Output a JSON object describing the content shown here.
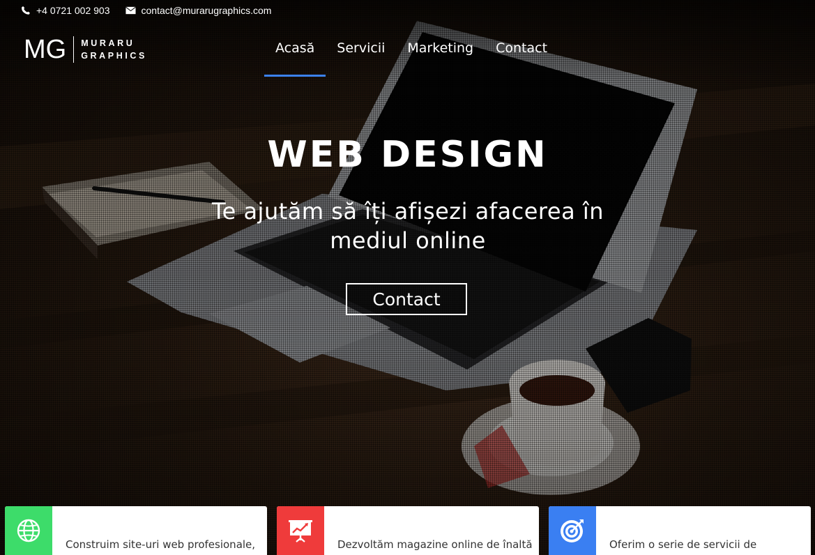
{
  "topbar": {
    "phone": "+4 0721 002 903",
    "email": "contact@murarugraphics.com",
    "phone_icon": "phone-icon",
    "email_icon": "envelope-icon"
  },
  "logo": {
    "initials": "MG",
    "line1": "MURARU",
    "line2": "GRAPHICS"
  },
  "nav": {
    "items": [
      {
        "label": "Acasă",
        "active": true
      },
      {
        "label": "Servicii"
      },
      {
        "label": "Marketing"
      },
      {
        "label": "Contact"
      }
    ],
    "accent": "#3c82f0"
  },
  "hero": {
    "title": "WEB DESIGN",
    "subtitle_line1": "Te ajutăm să îți afișezi afacerea în",
    "subtitle_line2": "mediul online",
    "button_label": "Contact"
  },
  "cards": [
    {
      "text": "Construim site-uri web profesionale,",
      "icon": "globe-icon",
      "color": "#3ddc6a"
    },
    {
      "text": "Dezvoltăm magazine online de înaltă",
      "icon": "presentation-chart-icon",
      "color": "#ef3b3b"
    },
    {
      "text": "Oferim o serie de servicii de",
      "icon": "target-icon",
      "color": "#3a7ff2"
    }
  ]
}
